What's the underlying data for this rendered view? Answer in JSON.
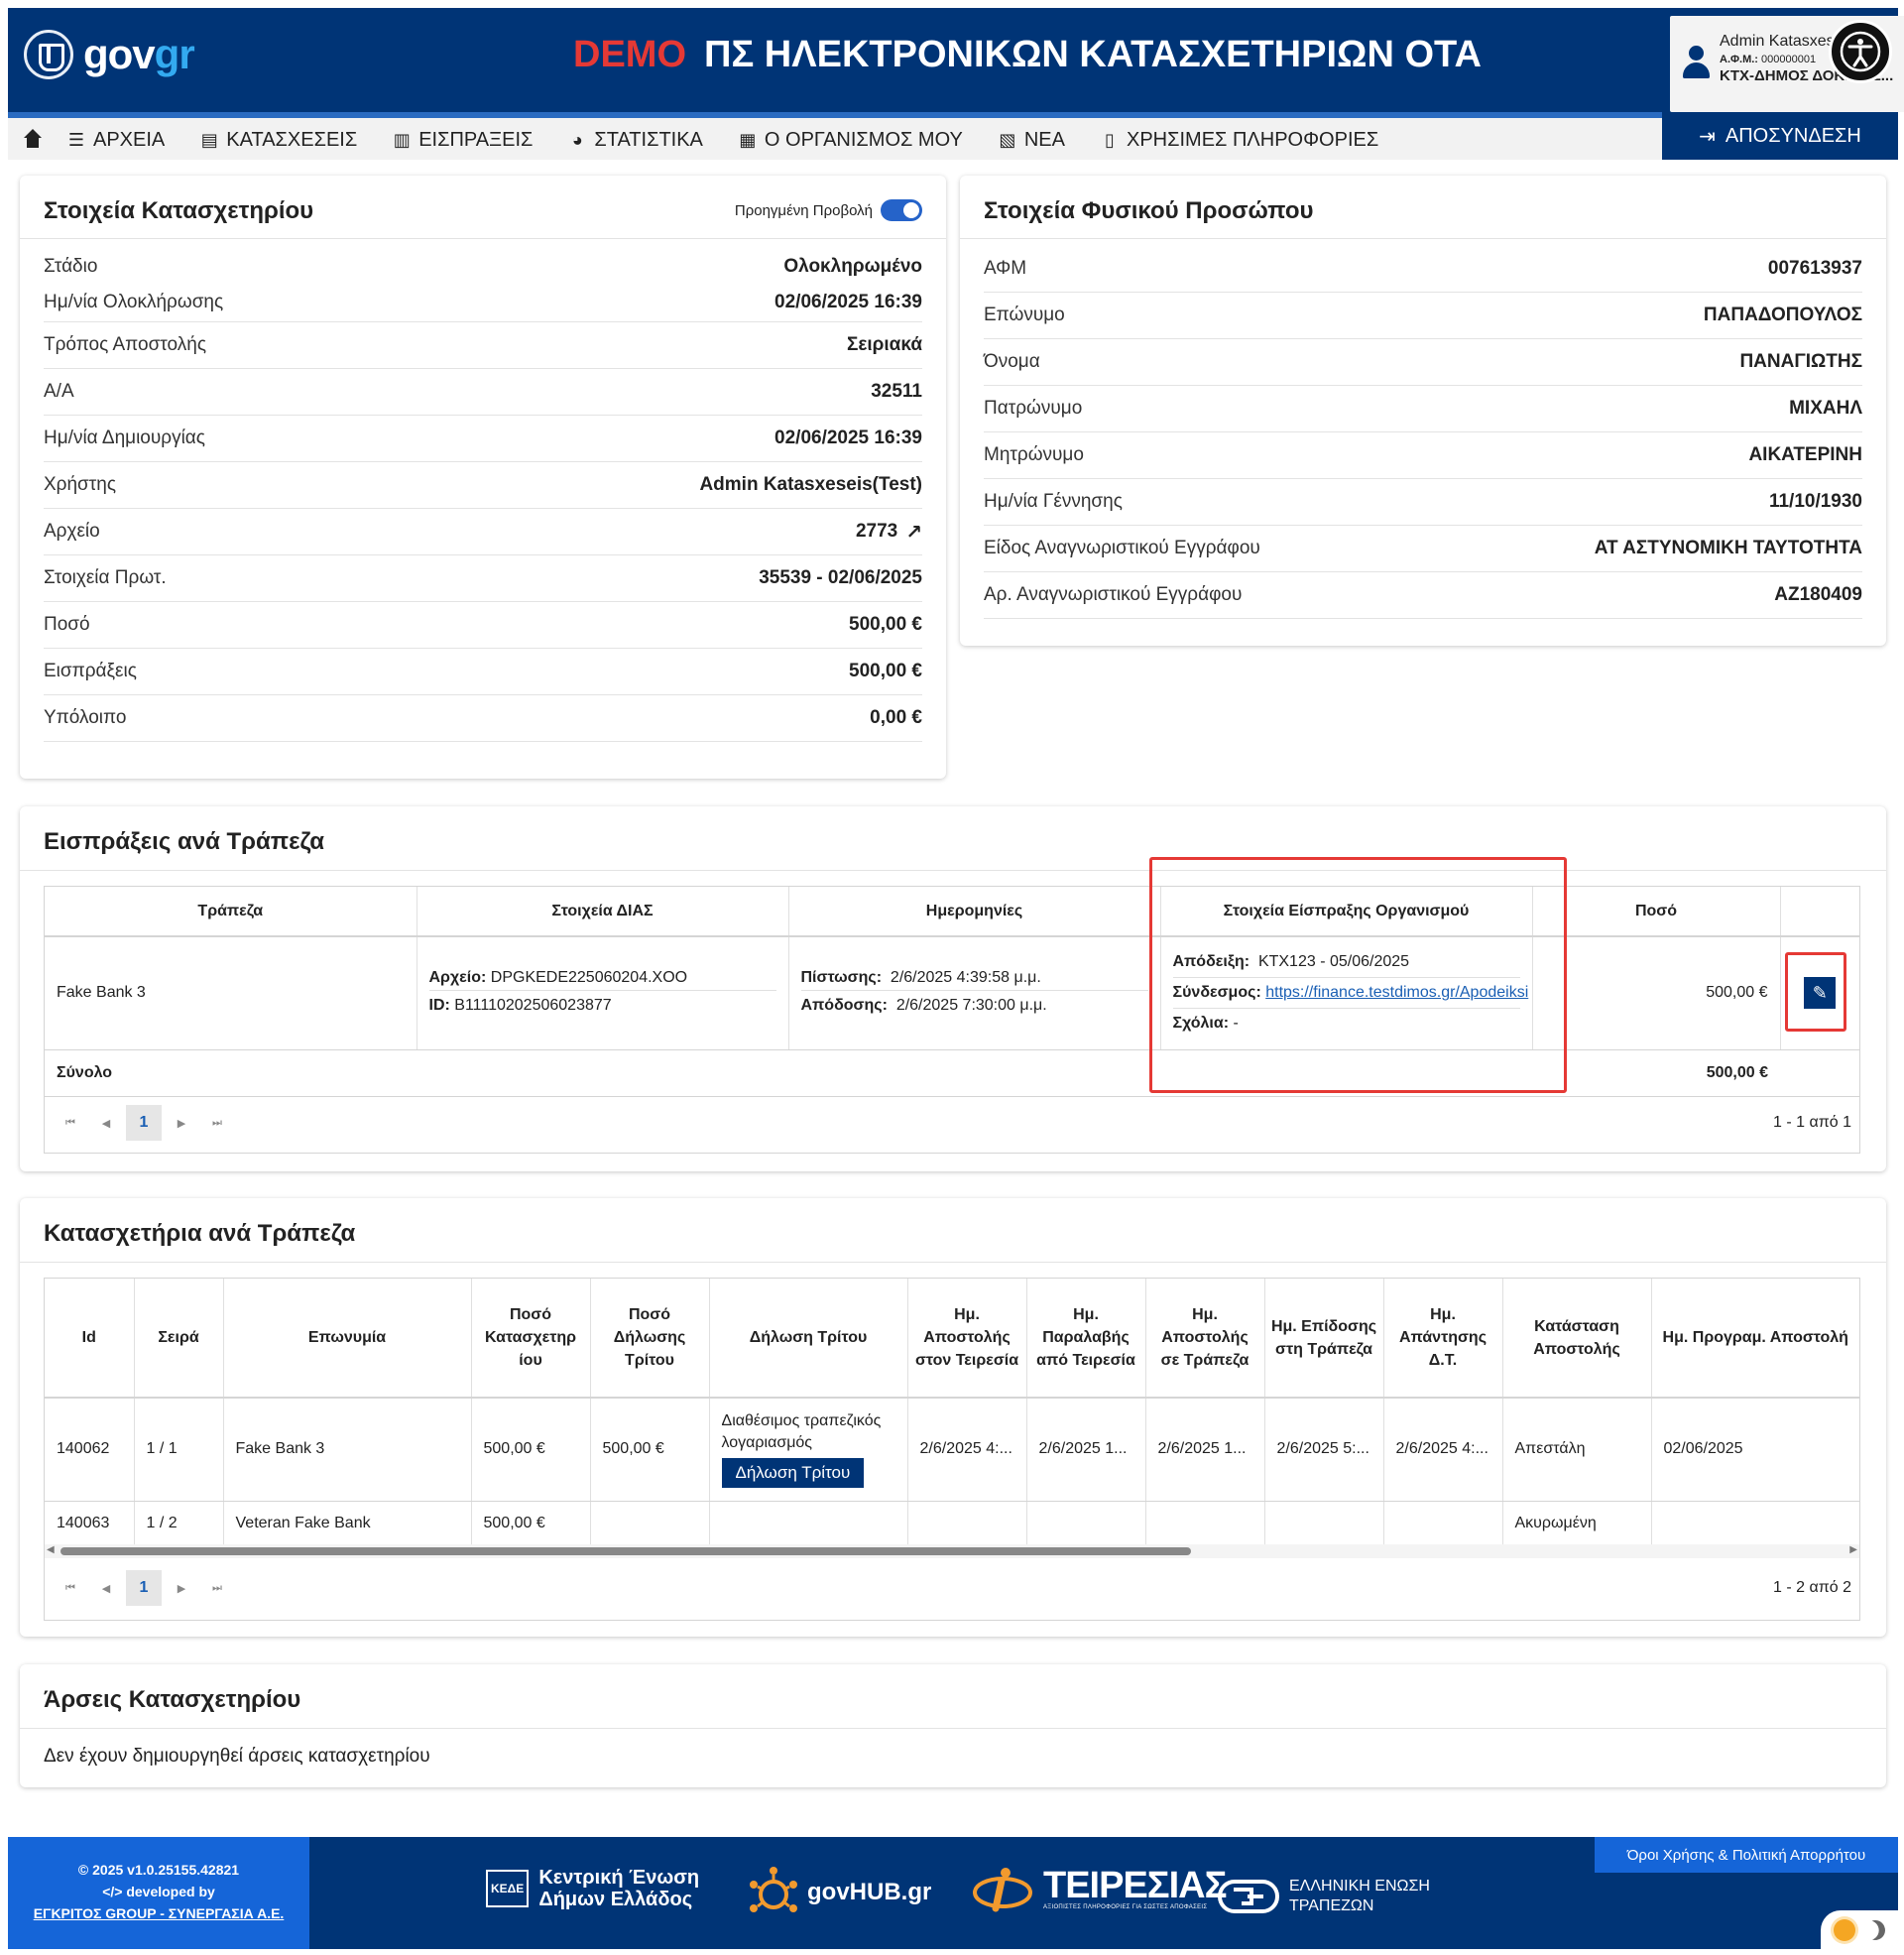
{
  "header": {
    "brand_gov": "gov",
    "brand_gr": "gr",
    "demo": "DEMO",
    "title": "ΠΣ ΗΛΕΚΤΡΟΝΙΚΩΝ ΚΑΤΑΣΧΕΤΗΡΙΩΝ ΟΤΑ",
    "user_name": "Admin Katasxes",
    "user_afm_label": "Α.Φ.Μ.:",
    "user_afm": "000000001",
    "user_org": "ΚΤΧ-ΔΗΜΟΣ ΔΟΚΙΜΑΣ..."
  },
  "nav": {
    "items": [
      {
        "label": "ΑΡΧΕΙΑ",
        "icon": "list-icon"
      },
      {
        "label": "ΚΑΤΑΣΧΕΣΕΙΣ",
        "icon": "table-icon"
      },
      {
        "label": "ΕΙΣΠΡΑΞΕΙΣ",
        "icon": "receipt-icon"
      },
      {
        "label": "ΣΤΑΤΙΣΤΙΚΑ",
        "icon": "pie-chart-icon"
      },
      {
        "label": "Ο ΟΡΓΑΝΙΣΜΟΣ ΜΟΥ",
        "icon": "building-icon"
      },
      {
        "label": "ΝΕΑ",
        "icon": "newspaper-icon"
      },
      {
        "label": "ΧΡΗΣΙΜΕΣ ΠΛΗΡΟΦΟΡΙΕΣ",
        "icon": "document-icon"
      }
    ],
    "logout": "ΑΠΟΣΥΝΔΕΣΗ"
  },
  "seizure": {
    "title": "Στοιχεία Κατασχετηρίου",
    "toggle_label": "Προηγμένη Προβολή",
    "rows": [
      {
        "k": "Στάδιο",
        "v": "Ολοκληρωμένο"
      },
      {
        "k": "Ημ/νία Ολοκλήρωσης",
        "v": "02/06/2025 16:39"
      },
      {
        "k": "Τρόπος Αποστολής",
        "v": "Σειριακά"
      },
      {
        "k": "Α/Α",
        "v": "32511"
      },
      {
        "k": "Ημ/νία Δημιουργίας",
        "v": "02/06/2025 16:39"
      },
      {
        "k": "Χρήστης",
        "v": "Admin Katasxeseis(Test)"
      },
      {
        "k": "Αρχείο",
        "v": "2773"
      },
      {
        "k": "Στοιχεία Πρωτ.",
        "v": "35539 - 02/06/2025"
      },
      {
        "k": "Ποσό",
        "v": "500,00 €"
      },
      {
        "k": "Εισπράξεις",
        "v": "500,00 €"
      },
      {
        "k": "Υπόλοιπο",
        "v": "0,00 €"
      }
    ]
  },
  "person": {
    "title": "Στοιχεία Φυσικού Προσώπου",
    "rows": [
      {
        "k": "ΑΦΜ",
        "v": "007613937"
      },
      {
        "k": "Επώνυμο",
        "v": "ΠΑΠΑΔΟΠΟΥΛΟΣ"
      },
      {
        "k": "Όνομα",
        "v": "ΠΑΝΑΓΙΩΤΗΣ"
      },
      {
        "k": "Πατρώνυμο",
        "v": "ΜΙΧΑΗΛ"
      },
      {
        "k": "Μητρώνυμο",
        "v": "ΑΙΚΑΤΕΡΙΝΗ"
      },
      {
        "k": "Ημ/νία Γέννησης",
        "v": "11/10/1930"
      },
      {
        "k": "Είδος Αναγνωριστικού Εγγράφου",
        "v": "ΑΤ ΑΣΤΥΝΟΜΙΚΗ ΤΑΥΤΟΤΗΤΑ"
      },
      {
        "k": "Αρ. Αναγνωριστικού Εγγράφου",
        "v": "ΑΖ180409"
      }
    ]
  },
  "receipts": {
    "title": "Εισπράξεις ανά Τράπεζα",
    "headers": [
      "Τράπεζα",
      "Στοιχεία ΔΙΑΣ",
      "Ημερομηνίες",
      "Στοιχεία Είσπραξης Οργανισμού",
      "Ποσό"
    ],
    "row": {
      "bank": "Fake Bank 3",
      "dias_file_label": "Αρχείο:",
      "dias_file": "DPGKEDE225060204.XOO",
      "dias_id_label": "ID:",
      "dias_id": "B11110202506023877",
      "credit_label": "Πίστωσης:",
      "credit": "2/6/2025 4:39:58 μ.μ.",
      "delivery_label": "Απόδοσης:",
      "delivery": "2/6/2025 7:30:00 μ.μ.",
      "receipt_label": "Απόδειξη:",
      "receipt": "KTX123 - 05/06/2025",
      "link_label": "Σύνδεσμος:",
      "link": "https://finance.testdimos.gr/Apodeiksi",
      "comments_label": "Σχόλια:",
      "comments": "-",
      "amount": "500,00 €"
    },
    "total_label": "Σύνολο",
    "total": "500,00 €",
    "page": "1",
    "info": "1 - 1 από 1",
    "highlight_color": "#e53935"
  },
  "seizures_by_bank": {
    "title": "Κατασχετήρια ανά Τράπεζα",
    "headers": [
      "Id",
      "Σειρά",
      "Επωνυμία",
      "Ποσό Κατασχετηρ ίου",
      "Ποσό Δήλωσης Τρίτου",
      "Δήλωση Τρίτου",
      "Ημ. Αποστολής στον Τειρεσία",
      "Ημ. Παραλαβής από Τειρεσία",
      "Ημ. Αποστολής σε Τράπεζα",
      "Ημ. Επίδοσης στη Τράπεζα",
      "Ημ. Απάντησης Δ.Τ.",
      "Κατάσταση Αποστολής",
      "Ημ. Προγραμ. Αποστολή"
    ],
    "rows": [
      {
        "id": "140062",
        "order": "1 / 1",
        "name": "Fake Bank 3",
        "amount": "500,00 €",
        "decl_amount": "500,00 €",
        "decl_text": "Διαθέσιμος τραπεζικός λογαριασμός",
        "decl_button": "Δήλωση Τρίτου",
        "d1": "2/6/2025 4:...",
        "d2": "2/6/2025 1...",
        "d3": "2/6/2025 1...",
        "d4": "2/6/2025 5:...",
        "d5": "2/6/2025 4:...",
        "status": "Απεστάλη",
        "sched": "02/06/2025"
      },
      {
        "id": "140063",
        "order": "1 / 2",
        "name": "Veteran Fake Bank",
        "amount": "500,00 €",
        "decl_amount": "",
        "decl_text": "",
        "decl_button": "",
        "d1": "",
        "d2": "",
        "d3": "",
        "d4": "",
        "d5": "",
        "status": "Ακυρωμένη",
        "sched": ""
      }
    ],
    "page": "1",
    "info": "1 - 2 από 2"
  },
  "lifts": {
    "title": "Άρσεις Κατασχετηρίου",
    "empty": "Δεν έχουν δημιουργηθεί άρσεις κατασχετηρίου"
  },
  "footer": {
    "version": "2025 v1.0.25155.42821",
    "developed": "developed by",
    "developer": "ΕΓΚΡΙΤΟΣ GROUP - ΣΥΝΕΡΓΑΣΙΑ Α.Ε.",
    "terms": "Όροι Χρήσης & Πολιτική Απορρήτου",
    "kede_1": "Κεντρική Ένωση",
    "kede_2": "Δήμων Ελλάδος",
    "kede_badge": "ΚΕΔΕ",
    "govhub": "govHUB.gr",
    "teiresias": "ΤΕΙΡΕΣΙΑΣ",
    "teiresias_sub": "ΑΞΙΟΠΙΣΤΕΣ ΠΛΗΡΟΦΟΡΙΕΣ ΓΙΑ ΣΩΣΤΕΣ ΑΠΟΦΑΣΕΙΣ",
    "hba_1": "ΕΛΛΗΝΙΚΗ ΕΝΩΣΗ",
    "hba_2": "ΤΡΑΠΕΖΩΝ"
  }
}
